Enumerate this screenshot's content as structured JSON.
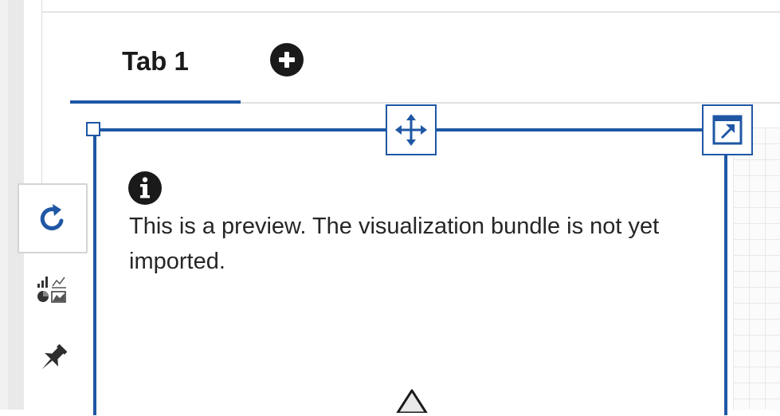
{
  "tabs": [
    {
      "label": "Tab 1",
      "active": true
    }
  ],
  "tab_bar": {
    "add_icon": "plus-circle-icon"
  },
  "side_toolbar": {
    "items": [
      {
        "icon": "refresh-icon",
        "active": true
      },
      {
        "icon": "visualizations-icon",
        "active": false
      },
      {
        "icon": "pin-icon",
        "active": false
      }
    ]
  },
  "widget": {
    "info_icon": "info-icon",
    "message": "This is a preview. The visualization bundle is not yet imported.",
    "move_icon": "move-icon",
    "expand_icon": "expand-icon"
  },
  "colors": {
    "accent": "#1f57a4",
    "text": "#262626",
    "icon_dark": "#1a1a1a"
  }
}
